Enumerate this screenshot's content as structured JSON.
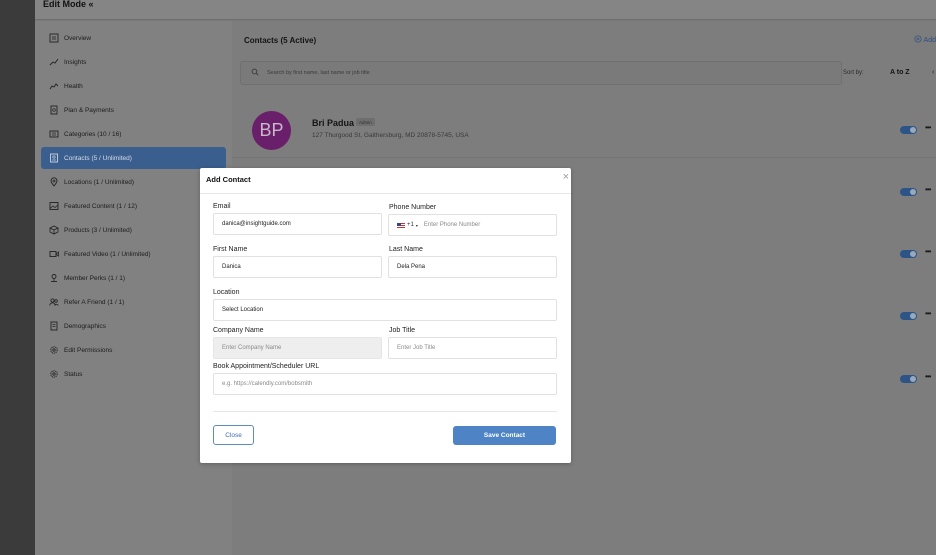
{
  "topbar": {
    "title": "Edit Mode «"
  },
  "sidebar": {
    "items": [
      {
        "label": "Overview",
        "icon": "overview-icon",
        "active": false
      },
      {
        "label": "Insights",
        "icon": "insights-icon",
        "active": false
      },
      {
        "label": "Health",
        "icon": "health-icon",
        "active": false
      },
      {
        "label": "Plan & Payments",
        "icon": "payments-icon",
        "active": false
      },
      {
        "label": "Categories (10 / 16)",
        "icon": "categories-icon",
        "active": false
      },
      {
        "label": "Contacts (5 / Unlimited)",
        "icon": "contacts-icon",
        "active": true
      },
      {
        "label": "Locations (1 / Unlimited)",
        "icon": "location-pin-icon",
        "active": false
      },
      {
        "label": "Featured Content (1 / 12)",
        "icon": "image-icon",
        "active": false
      },
      {
        "label": "Products (3 / Unlimited)",
        "icon": "box-icon",
        "active": false
      },
      {
        "label": "Featured Video (1 / Unlimited)",
        "icon": "video-icon",
        "active": false
      },
      {
        "label": "Member Perks (1 / 1)",
        "icon": "perks-icon",
        "active": false
      },
      {
        "label": "Refer A Friend (1 / 1)",
        "icon": "refer-icon",
        "active": false
      },
      {
        "label": "Demographics",
        "icon": "demographics-icon",
        "active": false
      },
      {
        "label": "Edit Permissions",
        "icon": "gear-icon",
        "active": false
      },
      {
        "label": "Status",
        "icon": "status-gear-icon",
        "active": false
      }
    ]
  },
  "main": {
    "title": "Contacts (5 Active)",
    "add_label": "Add",
    "search_placeholder": "Search by first name, last name or job title",
    "sort_label": "Sort by:",
    "sort_value": "A to Z",
    "contact": {
      "initials": "BP",
      "name": "Bri Padua",
      "badge": "Admin",
      "address": "127 Thurgood St, Gaithersburg, MD 20878-5745, USA"
    }
  },
  "modal": {
    "title": "Add Contact",
    "close_glyph": "×",
    "fields": {
      "email": {
        "label": "Email",
        "value": "danica@insightguide.com"
      },
      "phone": {
        "label": "Phone Number",
        "prefix": "+1",
        "placeholder": "Enter Phone Number"
      },
      "first_name": {
        "label": "First Name",
        "value": "Danica"
      },
      "last_name": {
        "label": "Last Name",
        "value": "Dela Pena"
      },
      "location": {
        "label": "Location",
        "value": "Select Location"
      },
      "company": {
        "label": "Company Name",
        "placeholder": "Enter Company Name"
      },
      "job_title": {
        "label": "Job Title",
        "placeholder": "Enter Job Title"
      },
      "book_url": {
        "label": "Book Appointment/Scheduler URL",
        "placeholder": "e.g. https://calendly.com/bobsmith"
      }
    },
    "close_button": "Close",
    "save_button": "Save Contact"
  },
  "colors": {
    "active_nav": "#3a5e8e",
    "primary_button": "#4e84c5",
    "toggle_on": "#2d5486"
  }
}
